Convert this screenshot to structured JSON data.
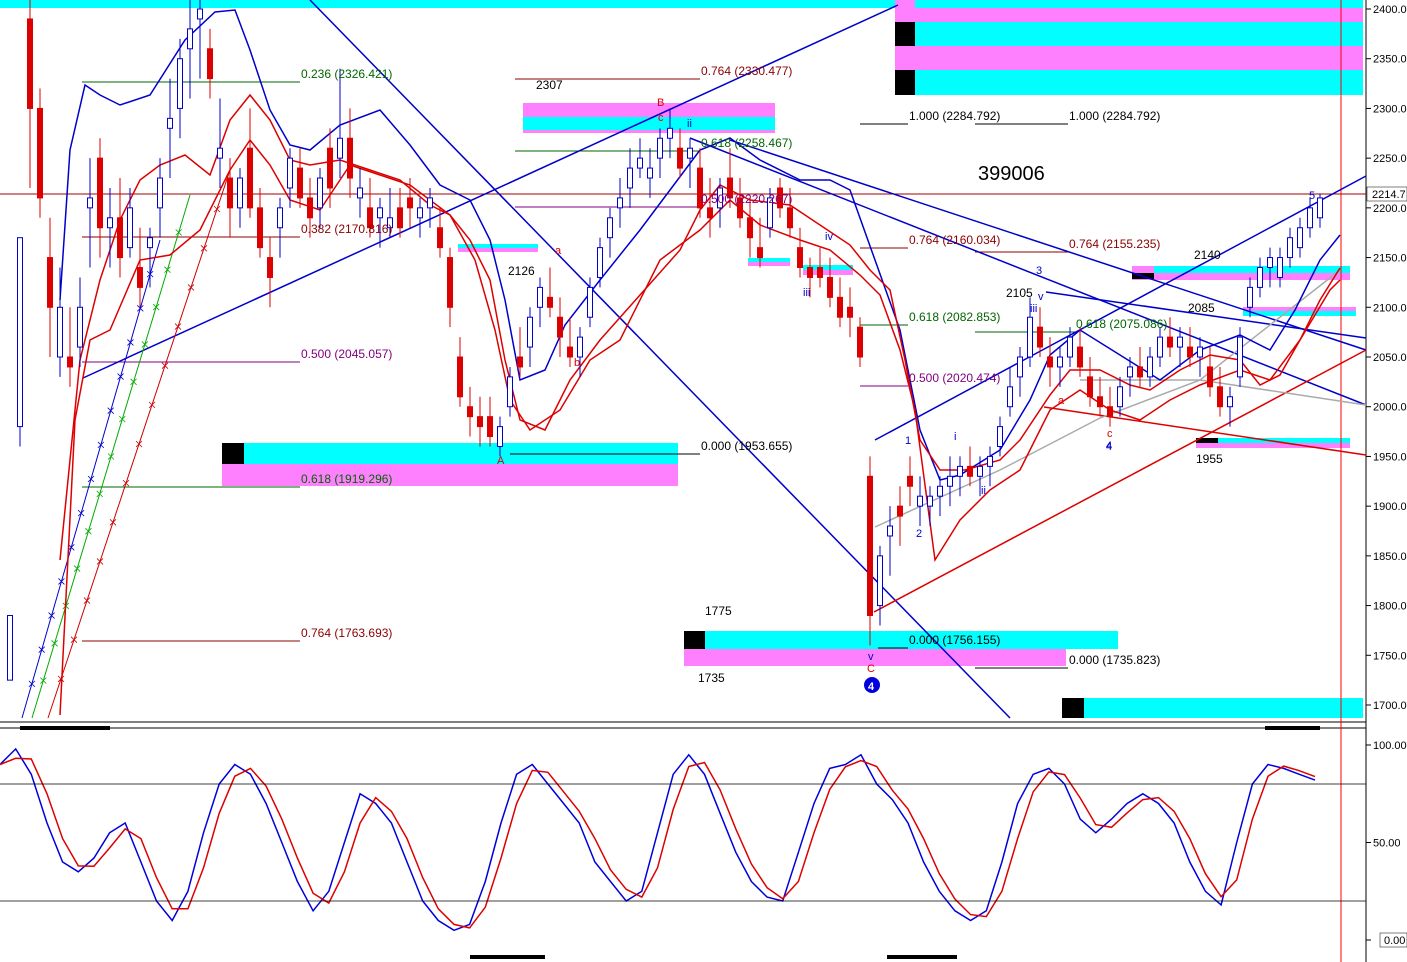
{
  "chart_data": {
    "type": "candlestick",
    "title": "399006",
    "price_axis": {
      "ylim": [
        1685,
        2410
      ],
      "ticks": [
        2400,
        2350,
        2300,
        2250,
        2200,
        2150,
        2100,
        2050,
        2000,
        1950,
        1900,
        1850,
        1800,
        1750,
        1700
      ],
      "current_price_label": "2214.7"
    },
    "oscillator_axis": {
      "ylim": [
        0,
        100
      ],
      "ticks": [
        "100.00",
        "50.00",
        "0.00"
      ],
      "levels": [
        80,
        20
      ]
    },
    "colors": {
      "up_candle": "#0000cc",
      "down_candle": "#dd0000",
      "flat_candle": "#000000",
      "band": "#0000cc",
      "ma": "#dd0000",
      "cyan": "#00ffff",
      "magenta": "#ff80ff",
      "fib_green": "#006600",
      "fib_maroon": "#8b0000",
      "fib_purple": "#800080"
    },
    "fib_levels": [
      {
        "text": "0.236 (2326.421)",
        "color": "green"
      },
      {
        "text": "0.382 (2170.816)",
        "color": "maroon"
      },
      {
        "text": "0.500 (2045.057)",
        "color": "purple"
      },
      {
        "text": "0.618 (1919.296)",
        "color": "green"
      },
      {
        "text": "0.764 (1763.693)",
        "color": "maroon"
      },
      {
        "text": "0.764 (2330.477)",
        "color": "maroon"
      },
      {
        "text": "0.618 (2258.467)",
        "color": "green"
      },
      {
        "text": "0.500 (2220.267)",
        "color": "purple"
      },
      {
        "text": "1.000 (2284.792)",
        "color": "black"
      },
      {
        "text": "1.000 (2284.792)",
        "color": "black"
      },
      {
        "text": "0.764 (2160.034)",
        "color": "maroon"
      },
      {
        "text": "0.764 (2155.235)",
        "color": "maroon"
      },
      {
        "text": "0.618 (2082.853)",
        "color": "green"
      },
      {
        "text": "0.618 (2075.086)",
        "color": "green"
      },
      {
        "text": "0.500 (2020.474)",
        "color": "purple"
      },
      {
        "text": "0.000 (1953.655)",
        "color": "black"
      },
      {
        "text": "0.000 (1756.155)",
        "color": "black"
      },
      {
        "text": "0.000 (1735.823)",
        "color": "black"
      }
    ],
    "price_labels": [
      "2307",
      "2126",
      "2105",
      "2085",
      "2140",
      "1775",
      "1735",
      "1955"
    ],
    "wave_labels": [
      {
        "text": "B",
        "color": "red"
      },
      {
        "text": "c",
        "color": "red"
      },
      {
        "text": "ii",
        "color": "blue"
      },
      {
        "text": "a",
        "color": "red"
      },
      {
        "text": "b",
        "color": "red"
      },
      {
        "text": "A",
        "color": "red"
      },
      {
        "text": "iv",
        "color": "blue"
      },
      {
        "text": "iii",
        "color": "blue"
      },
      {
        "text": "v",
        "color": "blue"
      },
      {
        "text": "C",
        "color": "red"
      },
      {
        "text": "4",
        "color": "blue"
      },
      {
        "text": "1",
        "color": "blue"
      },
      {
        "text": "2",
        "color": "blue"
      },
      {
        "text": "i",
        "color": "blue"
      },
      {
        "text": "ii",
        "color": "blue"
      },
      {
        "text": "3",
        "color": "blue"
      },
      {
        "text": "iii",
        "color": "blue"
      },
      {
        "text": "v",
        "color": "blue"
      },
      {
        "text": "a",
        "color": "red"
      },
      {
        "text": "c",
        "color": "red"
      },
      {
        "text": "4",
        "color": "blue"
      },
      {
        "text": "5",
        "color": "blue"
      }
    ]
  }
}
